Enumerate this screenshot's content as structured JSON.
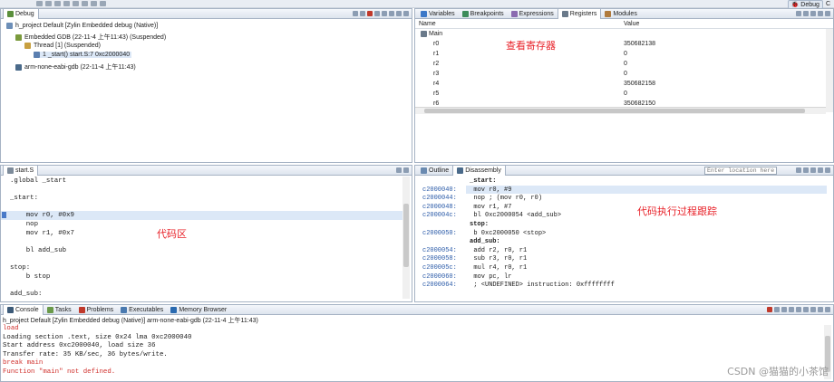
{
  "perspective": {
    "label": "Debug",
    "extra": "C"
  },
  "debug_view": {
    "tab_label": "Debug",
    "tree": [
      "h_project Default [Zylin Embedded debug (Native)]",
      "Embedded GDB (22-11-4 上午11:43) (Suspended)",
      "Thread [1] (Suspended)",
      "1 _start() start.S:7 0xc2000040",
      "arm-none-eabi-gdb (22-11-4 上午11:43)"
    ]
  },
  "registers_view": {
    "tabs": [
      "Variables",
      "Breakpoints",
      "Expressions",
      "Registers",
      "Modules"
    ],
    "columns": [
      "Name",
      "Value"
    ],
    "group": "Main",
    "rows": [
      {
        "name": "r0",
        "value": "350682138"
      },
      {
        "name": "r1",
        "value": "0"
      },
      {
        "name": "r2",
        "value": "0"
      },
      {
        "name": "r3",
        "value": "0"
      },
      {
        "name": "r4",
        "value": "350682158"
      },
      {
        "name": "r5",
        "value": "0"
      },
      {
        "name": "r6",
        "value": "350682150"
      }
    ],
    "annotation": "查看寄存器"
  },
  "editor_view": {
    "tab_label": "start.S",
    "lines": [
      ".global _start",
      "",
      "_start:",
      "",
      "    mov r0, #0x9",
      "    nop",
      "    mov r1, #0x7",
      "",
      "    bl add_sub",
      "",
      "stop:",
      "    b stop",
      "",
      "add_sub:"
    ],
    "annotation": "代码区"
  },
  "disassembly_view": {
    "tabs": [
      "Outline",
      "Disassembly"
    ],
    "goto_placeholder": "Enter location here",
    "lines": [
      {
        "addr": "",
        "text": "_start:"
      },
      {
        "addr": "c2000040:",
        "text": "  mov r0, #9"
      },
      {
        "addr": "c2000044:",
        "text": "  nop ; (mov r0, r0)"
      },
      {
        "addr": "c2000048:",
        "text": "  mov r1, #7"
      },
      {
        "addr": "c200004c:",
        "text": "  bl 0xc2000054 <add_sub>"
      },
      {
        "addr": "",
        "text": "stop:"
      },
      {
        "addr": "c2000050:",
        "text": "  b 0xc2000050 <stop>"
      },
      {
        "addr": "",
        "text": "add_sub:"
      },
      {
        "addr": "c2000054:",
        "text": "  add r2, r0, r1"
      },
      {
        "addr": "c2000058:",
        "text": "  sub r3, r0, r1"
      },
      {
        "addr": "c200005c:",
        "text": "  mul r4, r0, r1"
      },
      {
        "addr": "c2000060:",
        "text": "  mov pc, lr"
      },
      {
        "addr": "c2000064:",
        "text": "  ; <UNDEFINED> instruction: 0xffffffff"
      }
    ],
    "annotation": "代码执行过程跟踪"
  },
  "console_view": {
    "tabs": [
      "Console",
      "Tasks",
      "Problems",
      "Executables",
      "Memory Browser"
    ],
    "session": "h_project Default [Zylin Embedded debug (Native)] arm-none-eabi-gdb (22-11-4 上午11:43)",
    "lines": [
      {
        "text": "load",
        "color": "#d0312d"
      },
      {
        "text": "Loading section .text, size 0x24 lma 0xc2000040",
        "color": "#222222"
      },
      {
        "text": "Start address 0xc2000040, load size 36",
        "color": "#222222"
      },
      {
        "text": "Transfer rate: 35 KB/sec, 36 bytes/write.",
        "color": "#222222"
      },
      {
        "text": "break main",
        "color": "#d0312d"
      },
      {
        "text": "Function \"main\" not defined.",
        "color": "#d0312d"
      }
    ]
  },
  "watermark": "CSDN @猫猫的小茶馆",
  "colors": {
    "annotation_red": "#e8232a",
    "current_line": "#dce8f7",
    "error_text": "#d0312d"
  }
}
